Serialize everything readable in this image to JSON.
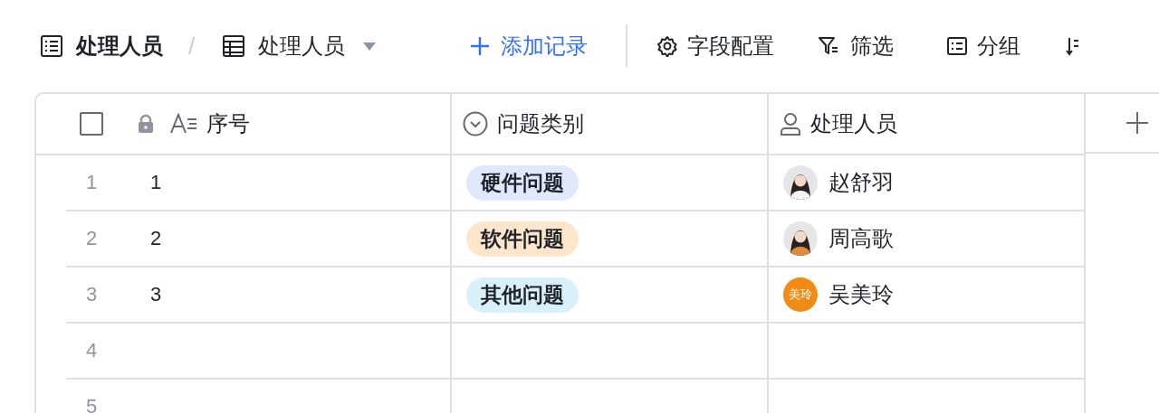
{
  "toolbar": {
    "separator": "/",
    "breadcrumb": [
      {
        "kind": "doc",
        "label": "处理人员"
      },
      {
        "kind": "view",
        "label": "处理人员"
      }
    ],
    "add_record": "添加记录",
    "actions": [
      {
        "kind": "fields",
        "label": "字段配置"
      },
      {
        "kind": "filter",
        "label": "筛选"
      },
      {
        "kind": "group",
        "label": "分组"
      },
      {
        "kind": "sort"
      }
    ]
  },
  "table": {
    "header_checkbox": {
      "checked": false
    },
    "columns": [
      {
        "kind": "text",
        "label": "序号",
        "locked": true
      },
      {
        "kind": "select",
        "label": "问题类别"
      },
      {
        "kind": "person",
        "label": "处理人员"
      }
    ],
    "rows": [
      {
        "number": "1",
        "seq": "1",
        "category": {
          "label": "硬件问题",
          "color": "#dfe8fd"
        },
        "person": {
          "name": "赵舒羽"
        }
      },
      {
        "number": "2",
        "seq": "2",
        "category": {
          "label": "软件问题",
          "color": "#fde6cc"
        },
        "person": {
          "name": "周高歌"
        }
      },
      {
        "number": "3",
        "seq": "3",
        "category": {
          "label": "其他问题",
          "color": "#d8f0fa"
        },
        "person": {
          "name": "吴美玲",
          "avatar": {
            "kind": "initials",
            "text": "美玲",
            "color": "#f28b15"
          }
        }
      },
      {
        "number": "4"
      },
      {
        "number": "5"
      }
    ]
  }
}
